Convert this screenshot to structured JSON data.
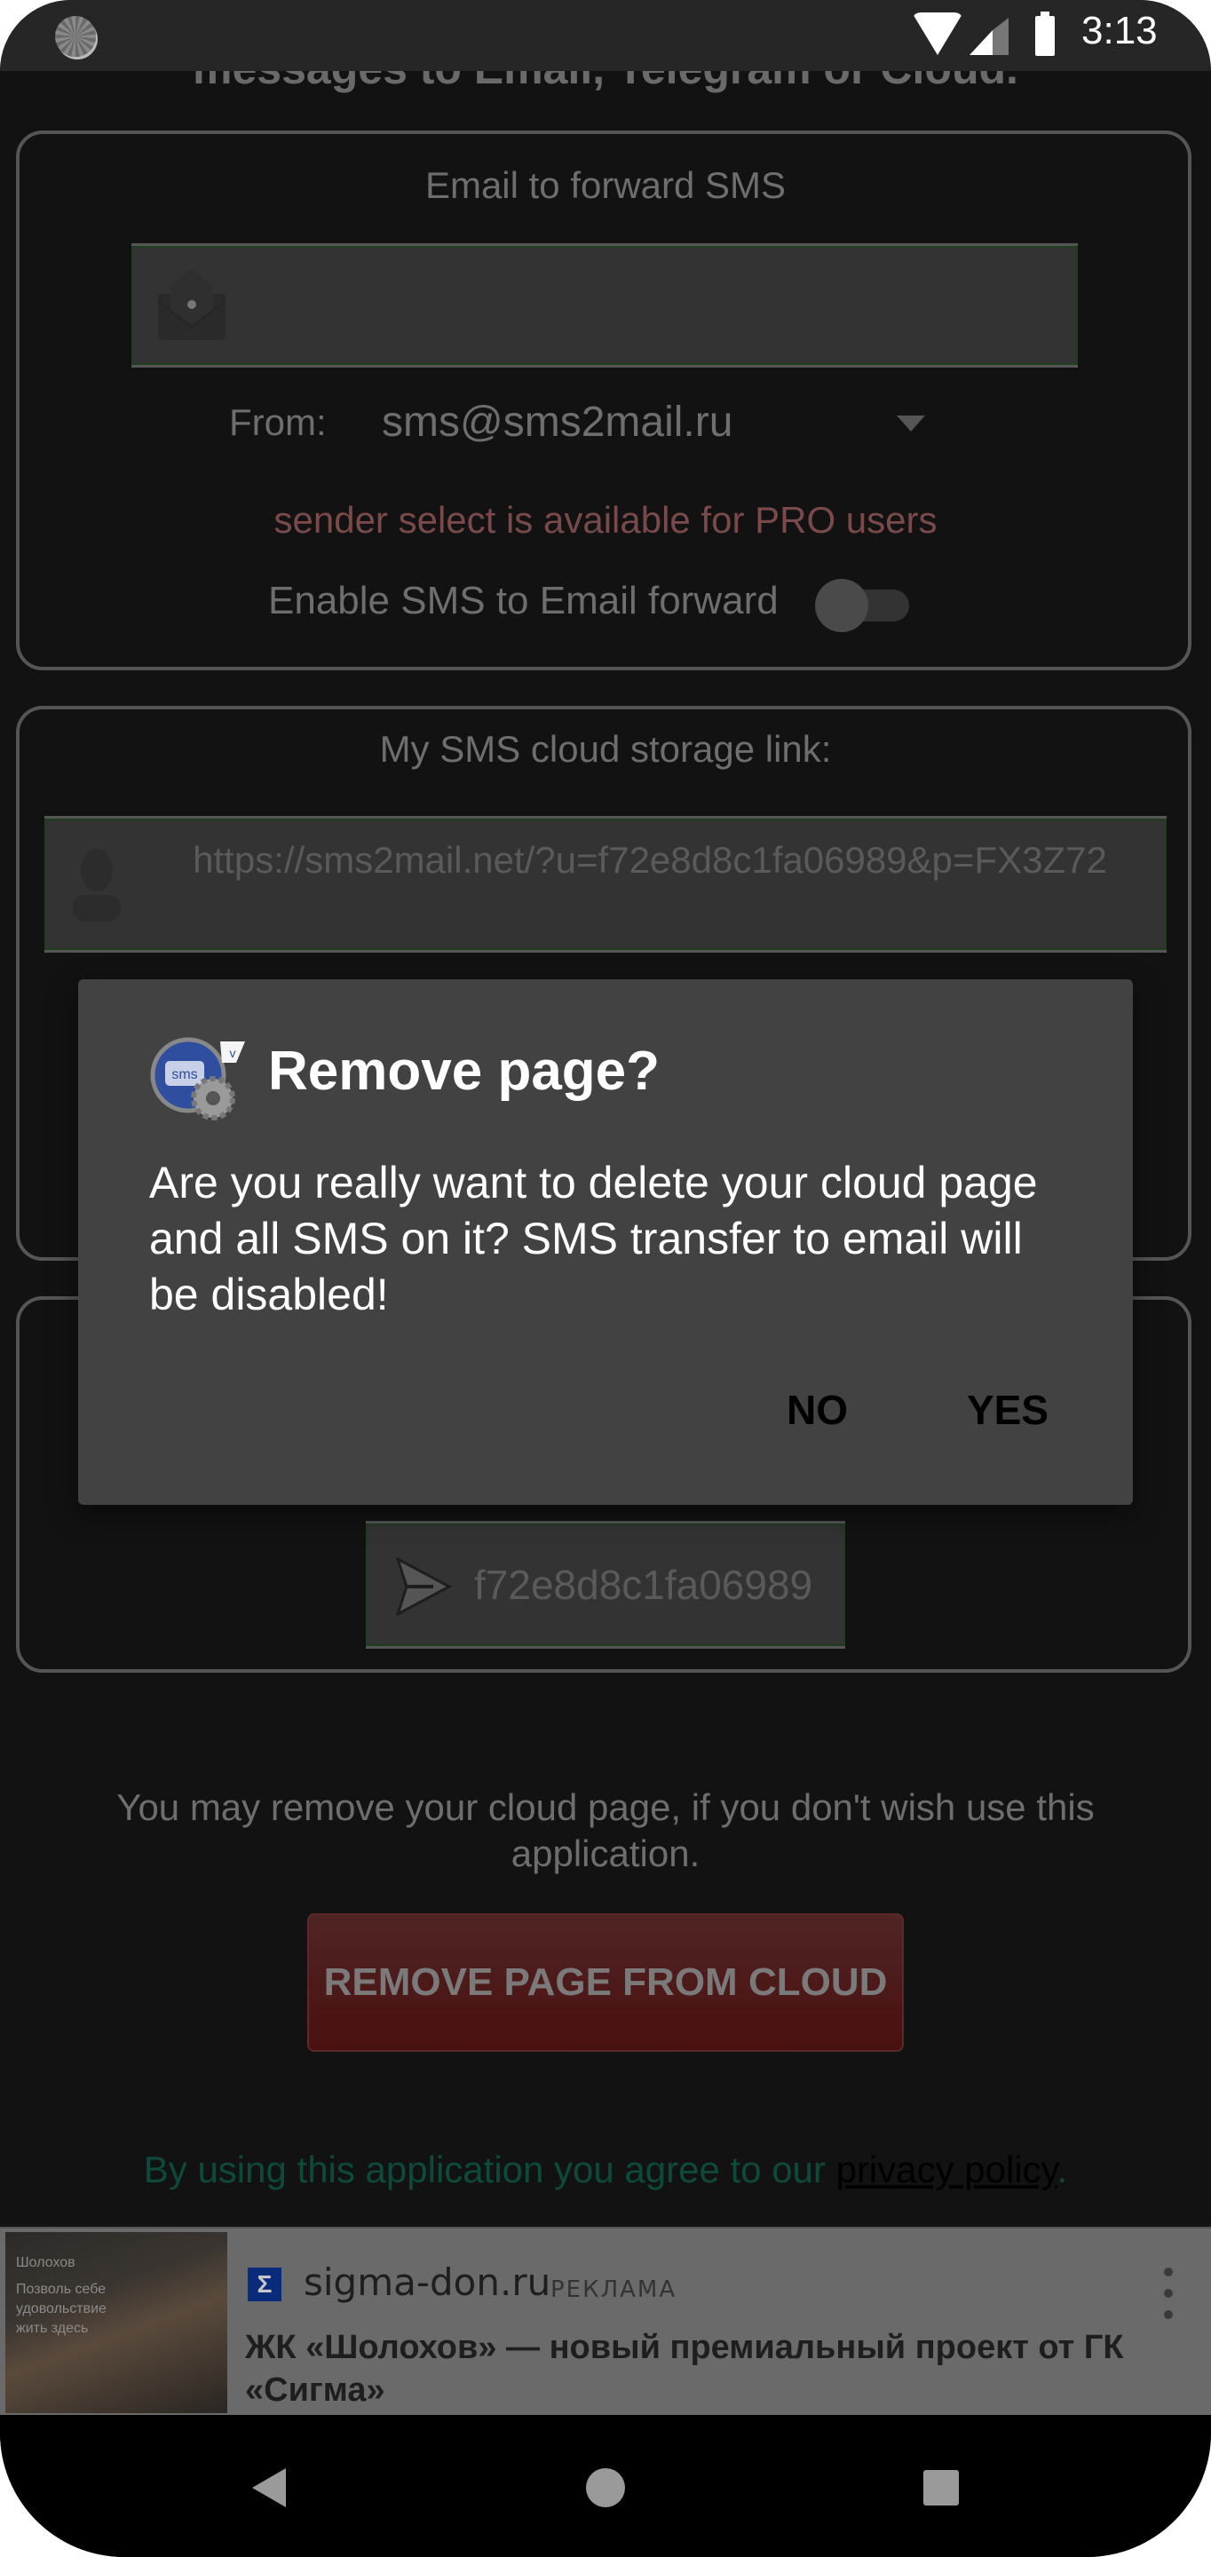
{
  "status_bar": {
    "time": "3:13",
    "icons": [
      "app-sync-icon",
      "wifi-icon",
      "cell-signal-icon",
      "battery-icon"
    ]
  },
  "header": {
    "text": "messages to Email, Telegram or Cloud."
  },
  "email_card": {
    "title": "Email to forward SMS",
    "email_input_value": "",
    "email_input_icon": "envelope-icon",
    "from_label": "From:",
    "from_selected": "sms@sms2mail.ru",
    "pro_note": "sender select is available for PRO users",
    "enable_label": "Enable SMS to Email forward",
    "enable_toggle_on": false
  },
  "cloud_card": {
    "title": "My SMS cloud storage link:",
    "link_icon": "person-icon",
    "link_value": "https://sms2mail.net/?u=f72e8d8c1fa06989&p=FX3Z72"
  },
  "telegram_card": {
    "token_icon": "send-icon",
    "token_value": "f72e8d8c1fa06989"
  },
  "remove_section": {
    "note": "You may remove your cloud page, if you don't wish use this application.",
    "button_label": "REMOVE PAGE FROM CLOUD"
  },
  "privacy": {
    "text": "By using this application you agree to our ",
    "link_label": "privacy policy",
    "suffix": "."
  },
  "dialog": {
    "icon": "sms-settings-app-icon",
    "title": "Remove page?",
    "message": "Are you really want to delete your cloud page and all SMS on it? SMS transfer to email will be disabled!",
    "no_label": "NO",
    "yes_label": "YES"
  },
  "ad": {
    "image_text": "Позволь себе удовольствие жить здесь",
    "image_brand": "Шолохов",
    "logo_glyph": "Σ",
    "domain": "sigma-don.ru",
    "tag": "РЕКЛАМА",
    "title": "ЖК «Шолохов» — новый премиальный проект от ГК «Сигма»"
  },
  "colors": {
    "background": "#121212",
    "dialog_bg": "#424242",
    "field_border": "#1f3d1f",
    "pro_note": "#7a4a4a",
    "remove_button": "#4a1010",
    "privacy_text": "#0d4a3c"
  }
}
